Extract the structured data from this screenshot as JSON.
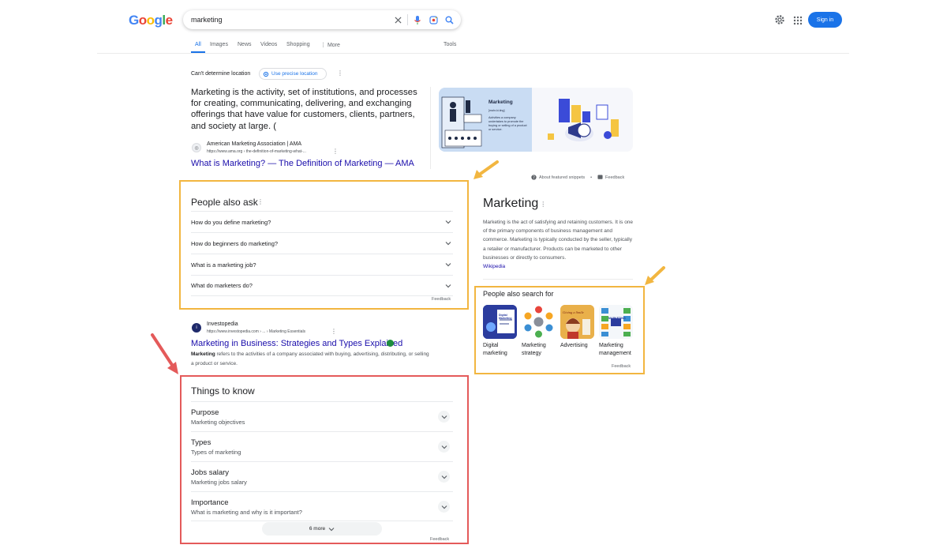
{
  "header": {
    "search_value": "marketing",
    "sign_in": "Sign in"
  },
  "tabs": [
    {
      "label": "All"
    },
    {
      "label": "Images"
    },
    {
      "label": "News"
    },
    {
      "label": "Videos"
    },
    {
      "label": "Shopping"
    },
    {
      "label": "More"
    },
    {
      "label": "Tools"
    }
  ],
  "location": {
    "text": "Can't determine location",
    "button": "Use precise location"
  },
  "featured_snippet": {
    "text": "Marketing is the activity, set of institutions, and processes for creating, communicating, delivering, and exchanging offerings that have value for customers, clients, partners, and society at large. (",
    "source_name": "American Marketing Association | AMA",
    "source_url": "https://www.ama.org › the-definition-of-marketing-what-...",
    "title": "What is Marketing? — The Definition of Marketing — AMA",
    "about": "About featured snippets",
    "feedback": "Feedback",
    "image": {
      "heading": "Marketing",
      "subheading": "[mahr-ki-ting]",
      "definition": "Activities a company undertakes to promote the buying or selling of a product or service."
    }
  },
  "people_also_ask": {
    "title": "People also ask",
    "questions": [
      "How do you define marketing?",
      "How do beginners do marketing?",
      "What is a marketing job?",
      "What do marketers do?"
    ],
    "feedback": "Feedback"
  },
  "investopedia": {
    "site": "Investopedia",
    "url": "https://www.investopedia.com › ... › Marketing Essentials",
    "title": "Marketing in Business: Strategies and Types Explained",
    "snippet_bold": "Marketing",
    "snippet_rest": " refers to the activities of a company associated with buying, advertising, distributing, or selling a product or service."
  },
  "things_to_know": {
    "title": "Things to know",
    "items": [
      {
        "title": "Purpose",
        "subtitle": "Marketing objectives"
      },
      {
        "title": "Types",
        "subtitle": "Types of marketing"
      },
      {
        "title": "Jobs salary",
        "subtitle": "Marketing jobs salary"
      },
      {
        "title": "Importance",
        "subtitle": "What is marketing and why is it important?"
      }
    ],
    "more": "6 more",
    "feedback": "Feedback"
  },
  "knowledge_panel": {
    "title": "Marketing",
    "description": "Marketing is the act of satisfying and retaining customers. It is one of the primary components of business management and commerce. Marketing is typically conducted by the seller, typically a retailer or manufacturer. Products can be marketed to other businesses or directly to consumers.",
    "source": "Wikipedia",
    "pasf_title": "People also search for",
    "pasf": [
      {
        "line1": "Digital",
        "line2": "marketing"
      },
      {
        "line1": "Marketing",
        "line2": "strategy"
      },
      {
        "line1": "Advertising",
        "line2": ""
      },
      {
        "line1": "Marketing",
        "line2": "management"
      }
    ],
    "pasf_thumb_text": {
      "digital": "Digital Marketing",
      "advertising": "Giving a Smile",
      "management": "MARKETING"
    },
    "feedback": "Feedback"
  },
  "colors": {
    "link": "#1a0dab",
    "accent": "#1a73e8",
    "highlight_orange": "#f2b640",
    "highlight_red": "#e45a5a"
  }
}
